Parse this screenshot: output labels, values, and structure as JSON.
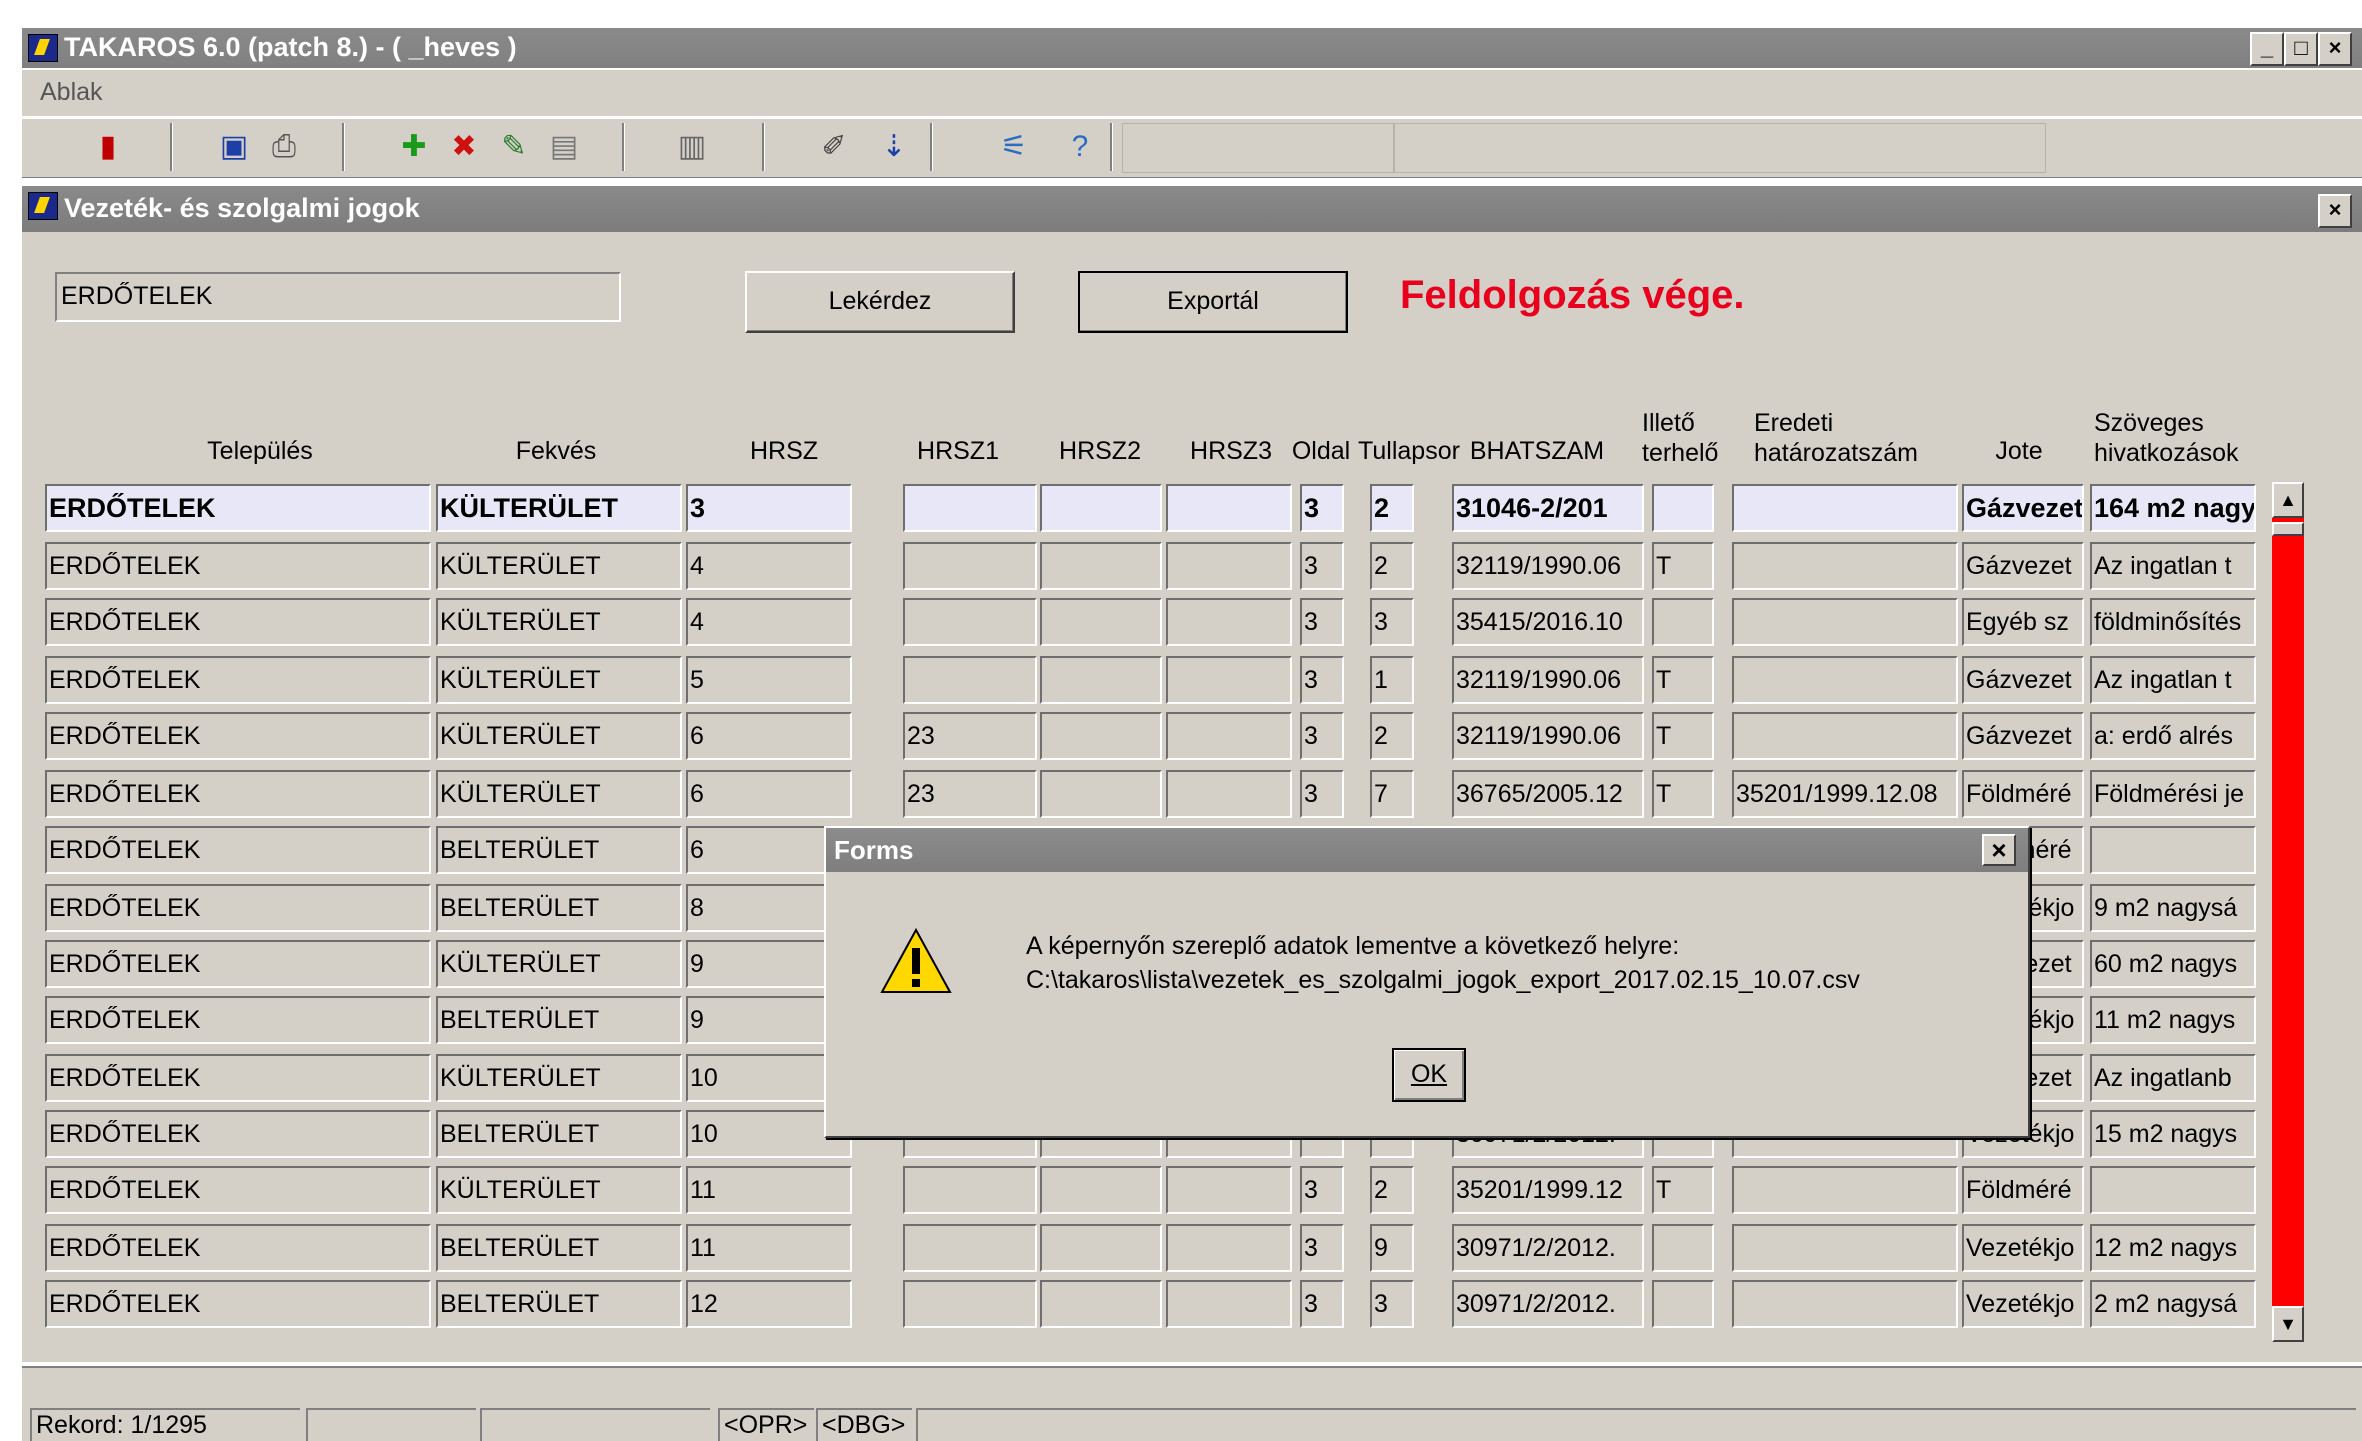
{
  "app": {
    "title": "TAKAROS 6.0 (patch 8.) - ( _heves )",
    "menu": "Ablak",
    "toolbar_icons": [
      "exit-door-icon",
      "save-icon",
      "print-icon",
      "add-record-icon",
      "delete-record-icon",
      "edit-record-icon",
      "clear-record-icon",
      "query-icon",
      "edit-icon",
      "download-icon",
      "filter-icon",
      "help-icon"
    ]
  },
  "window": {
    "title": "Vezeték- és szolgalmi jogok",
    "search_value": "ERDŐTELEK",
    "query_button": "Lekérdez",
    "export_button": "Exportál",
    "status_text": "Feldolgozás vége."
  },
  "table": {
    "headers": {
      "telepules": "Település",
      "fekves": "Fekvés",
      "hrsz": "HRSZ",
      "hrsz1": "HRSZ1",
      "hrsz2": "HRSZ2",
      "hrsz3": "HRSZ3",
      "oldal": "Oldal",
      "tullapsor": "Tullapsor",
      "bhatszam": "BHATSZAM",
      "illeto_1": "Illető",
      "illeto_2": "terhelő",
      "eredeti_1": "Eredeti",
      "eredeti_2": "határozatszám",
      "jote": "Jote",
      "szoveges_1": "Szöveges",
      "szoveges_2": "hivatkozások"
    },
    "rows": [
      [
        "ERDŐTELEK",
        "KÜLTERÜLET",
        "3",
        "",
        "",
        "",
        "3",
        "2",
        "31046-2/201",
        "",
        "",
        "Gázvezet",
        "164 m2 nagy"
      ],
      [
        "ERDŐTELEK",
        "KÜLTERÜLET",
        "4",
        "",
        "",
        "",
        "3",
        "2",
        "32119/1990.06",
        "T",
        "",
        "Gázvezet",
        "Az ingatlan t"
      ],
      [
        "ERDŐTELEK",
        "KÜLTERÜLET",
        "4",
        "",
        "",
        "",
        "3",
        "3",
        "35415/2016.10",
        "",
        "",
        "Egyéb sz",
        "földminősítés"
      ],
      [
        "ERDŐTELEK",
        "KÜLTERÜLET",
        "5",
        "",
        "",
        "",
        "3",
        "1",
        "32119/1990.06",
        "T",
        "",
        "Gázvezet",
        "Az ingatlan t"
      ],
      [
        "ERDŐTELEK",
        "KÜLTERÜLET",
        "6",
        "23",
        "",
        "",
        "3",
        "2",
        "32119/1990.06",
        "T",
        "",
        "Gázvezet",
        "a: erdő alrés"
      ],
      [
        "ERDŐTELEK",
        "KÜLTERÜLET",
        "6",
        "23",
        "",
        "",
        "3",
        "7",
        "36765/2005.12",
        "T",
        "35201/1999.12.08",
        "Földméré",
        "Földmérési je"
      ],
      [
        "ERDŐTELEK",
        "BELTERÜLET",
        "6",
        "",
        "",
        "",
        "",
        "",
        "",
        "",
        "",
        "Földméré",
        ""
      ],
      [
        "ERDŐTELEK",
        "BELTERÜLET",
        "8",
        "",
        "",
        "",
        "",
        "",
        "",
        "",
        "",
        "Vezetékjo",
        "9 m2 nagysá"
      ],
      [
        "ERDŐTELEK",
        "KÜLTERÜLET",
        "9",
        "",
        "",
        "",
        "",
        "",
        "",
        "",
        "",
        "Gázvezet",
        "60 m2 nagys"
      ],
      [
        "ERDŐTELEK",
        "BELTERÜLET",
        "9",
        "",
        "",
        "",
        "",
        "",
        "",
        "",
        "",
        "Vezetékjo",
        "11 m2 nagys"
      ],
      [
        "ERDŐTELEK",
        "KÜLTERÜLET",
        "10",
        "",
        "",
        "",
        "",
        "",
        "",
        "",
        "",
        "Gázvezet",
        "Az ingatlanb"
      ],
      [
        "ERDŐTELEK",
        "BELTERÜLET",
        "10",
        "",
        "",
        "",
        "",
        "",
        "30971/2/2012.",
        "",
        "",
        "Vezetékjo",
        "15 m2 nagys"
      ],
      [
        "ERDŐTELEK",
        "KÜLTERÜLET",
        "11",
        "",
        "",
        "",
        "3",
        "2",
        "35201/1999.12",
        "T",
        "",
        "Földméré",
        ""
      ],
      [
        "ERDŐTELEK",
        "BELTERÜLET",
        "11",
        "",
        "",
        "",
        "3",
        "9",
        "30971/2/2012.",
        "",
        "",
        "Vezetékjo",
        "12 m2 nagys"
      ],
      [
        "ERDŐTELEK",
        "BELTERÜLET",
        "12",
        "",
        "",
        "",
        "3",
        "3",
        "30971/2/2012.",
        "",
        "",
        "Vezetékjo",
        "2 m2 nagysá"
      ]
    ]
  },
  "statusbar": {
    "record": "Rekord: 1/1295",
    "opr": "<OPR>",
    "dbg": "<DBG>"
  },
  "dialog": {
    "title": "Forms",
    "line1": "A képernyőn szereplő adatok lementve a következő helyre:",
    "line2": "C:\\takaros\\lista\\vezetek_es_szolgalmi_jogok_export_2017.02.15_10.07.csv",
    "ok": "OK"
  },
  "colors": {
    "status_text": "#e8001c",
    "scrollbar_track": "#ff0000",
    "current_row": "#e7e7f8"
  }
}
